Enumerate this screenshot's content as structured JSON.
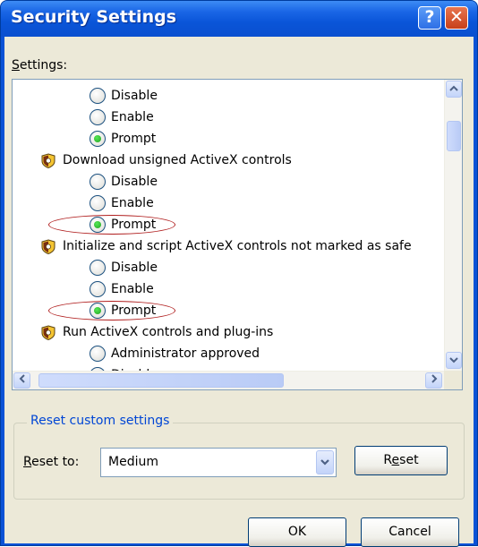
{
  "window": {
    "title": "Security Settings",
    "help_label": "?",
    "close_label": "✕"
  },
  "settings": {
    "label": "Settings:",
    "items": [
      {
        "type": "option",
        "label": "Disable",
        "checked": false
      },
      {
        "type": "option",
        "label": "Enable",
        "checked": false
      },
      {
        "type": "option",
        "label": "Prompt",
        "checked": true
      },
      {
        "type": "category",
        "label": "Download unsigned ActiveX controls",
        "icon": "shield-icon"
      },
      {
        "type": "option",
        "label": "Disable",
        "checked": false
      },
      {
        "type": "option",
        "label": "Enable",
        "checked": false
      },
      {
        "type": "option",
        "label": "Prompt",
        "checked": true,
        "circled": true
      },
      {
        "type": "category",
        "label": "Initialize and script ActiveX controls not marked as safe",
        "icon": "shield-icon"
      },
      {
        "type": "option",
        "label": "Disable",
        "checked": false
      },
      {
        "type": "option",
        "label": "Enable",
        "checked": false
      },
      {
        "type": "option",
        "label": "Prompt",
        "checked": true,
        "circled": true
      },
      {
        "type": "category",
        "label": "Run ActiveX controls and plug-ins",
        "icon": "shield-icon"
      },
      {
        "type": "option",
        "label": "Administrator approved",
        "checked": false
      },
      {
        "type": "option",
        "label": "Disable",
        "checked": false
      }
    ]
  },
  "scrollbars": {
    "vertical_position": 0.1,
    "horizontal_position": 0.05
  },
  "reset_group": {
    "legend": "Reset custom settings",
    "reset_to_label": "Reset to:",
    "selected_value": "Medium",
    "reset_button_label": "Reset"
  },
  "footer": {
    "ok_label": "OK",
    "cancel_label": "Cancel"
  },
  "colors": {
    "title_bar": "#0a55d8",
    "dialog_bg": "#ece9d8",
    "annotation_oval": "#b01e1e",
    "group_legend": "#0046d5"
  }
}
